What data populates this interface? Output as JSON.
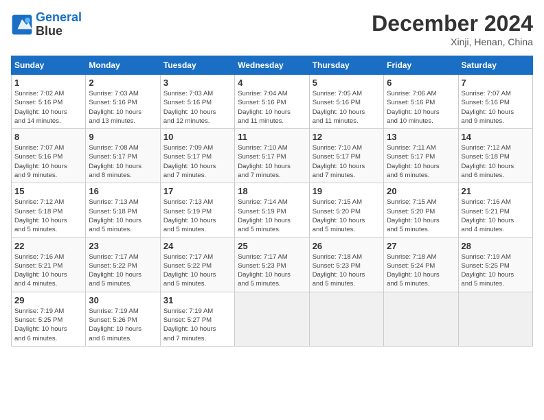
{
  "header": {
    "logo_line1": "General",
    "logo_line2": "Blue",
    "month": "December 2024",
    "location": "Xinji, Henan, China"
  },
  "weekdays": [
    "Sunday",
    "Monday",
    "Tuesday",
    "Wednesday",
    "Thursday",
    "Friday",
    "Saturday"
  ],
  "weeks": [
    [
      {
        "day": "1",
        "info": "Sunrise: 7:02 AM\nSunset: 5:16 PM\nDaylight: 10 hours\nand 14 minutes."
      },
      {
        "day": "2",
        "info": "Sunrise: 7:03 AM\nSunset: 5:16 PM\nDaylight: 10 hours\nand 13 minutes."
      },
      {
        "day": "3",
        "info": "Sunrise: 7:03 AM\nSunset: 5:16 PM\nDaylight: 10 hours\nand 12 minutes."
      },
      {
        "day": "4",
        "info": "Sunrise: 7:04 AM\nSunset: 5:16 PM\nDaylight: 10 hours\nand 11 minutes."
      },
      {
        "day": "5",
        "info": "Sunrise: 7:05 AM\nSunset: 5:16 PM\nDaylight: 10 hours\nand 11 minutes."
      },
      {
        "day": "6",
        "info": "Sunrise: 7:06 AM\nSunset: 5:16 PM\nDaylight: 10 hours\nand 10 minutes."
      },
      {
        "day": "7",
        "info": "Sunrise: 7:07 AM\nSunset: 5:16 PM\nDaylight: 10 hours\nand 9 minutes."
      }
    ],
    [
      {
        "day": "8",
        "info": "Sunrise: 7:07 AM\nSunset: 5:16 PM\nDaylight: 10 hours\nand 9 minutes."
      },
      {
        "day": "9",
        "info": "Sunrise: 7:08 AM\nSunset: 5:17 PM\nDaylight: 10 hours\nand 8 minutes."
      },
      {
        "day": "10",
        "info": "Sunrise: 7:09 AM\nSunset: 5:17 PM\nDaylight: 10 hours\nand 7 minutes."
      },
      {
        "day": "11",
        "info": "Sunrise: 7:10 AM\nSunset: 5:17 PM\nDaylight: 10 hours\nand 7 minutes."
      },
      {
        "day": "12",
        "info": "Sunrise: 7:10 AM\nSunset: 5:17 PM\nDaylight: 10 hours\nand 7 minutes."
      },
      {
        "day": "13",
        "info": "Sunrise: 7:11 AM\nSunset: 5:17 PM\nDaylight: 10 hours\nand 6 minutes."
      },
      {
        "day": "14",
        "info": "Sunrise: 7:12 AM\nSunset: 5:18 PM\nDaylight: 10 hours\nand 6 minutes."
      }
    ],
    [
      {
        "day": "15",
        "info": "Sunrise: 7:12 AM\nSunset: 5:18 PM\nDaylight: 10 hours\nand 5 minutes."
      },
      {
        "day": "16",
        "info": "Sunrise: 7:13 AM\nSunset: 5:18 PM\nDaylight: 10 hours\nand 5 minutes."
      },
      {
        "day": "17",
        "info": "Sunrise: 7:13 AM\nSunset: 5:19 PM\nDaylight: 10 hours\nand 5 minutes."
      },
      {
        "day": "18",
        "info": "Sunrise: 7:14 AM\nSunset: 5:19 PM\nDaylight: 10 hours\nand 5 minutes."
      },
      {
        "day": "19",
        "info": "Sunrise: 7:15 AM\nSunset: 5:20 PM\nDaylight: 10 hours\nand 5 minutes."
      },
      {
        "day": "20",
        "info": "Sunrise: 7:15 AM\nSunset: 5:20 PM\nDaylight: 10 hours\nand 5 minutes."
      },
      {
        "day": "21",
        "info": "Sunrise: 7:16 AM\nSunset: 5:21 PM\nDaylight: 10 hours\nand 4 minutes."
      }
    ],
    [
      {
        "day": "22",
        "info": "Sunrise: 7:16 AM\nSunset: 5:21 PM\nDaylight: 10 hours\nand 4 minutes."
      },
      {
        "day": "23",
        "info": "Sunrise: 7:17 AM\nSunset: 5:22 PM\nDaylight: 10 hours\nand 5 minutes."
      },
      {
        "day": "24",
        "info": "Sunrise: 7:17 AM\nSunset: 5:22 PM\nDaylight: 10 hours\nand 5 minutes."
      },
      {
        "day": "25",
        "info": "Sunrise: 7:17 AM\nSunset: 5:23 PM\nDaylight: 10 hours\nand 5 minutes."
      },
      {
        "day": "26",
        "info": "Sunrise: 7:18 AM\nSunset: 5:23 PM\nDaylight: 10 hours\nand 5 minutes."
      },
      {
        "day": "27",
        "info": "Sunrise: 7:18 AM\nSunset: 5:24 PM\nDaylight: 10 hours\nand 5 minutes."
      },
      {
        "day": "28",
        "info": "Sunrise: 7:19 AM\nSunset: 5:25 PM\nDaylight: 10 hours\nand 5 minutes."
      }
    ],
    [
      {
        "day": "29",
        "info": "Sunrise: 7:19 AM\nSunset: 5:25 PM\nDaylight: 10 hours\nand 6 minutes."
      },
      {
        "day": "30",
        "info": "Sunrise: 7:19 AM\nSunset: 5:26 PM\nDaylight: 10 hours\nand 6 minutes."
      },
      {
        "day": "31",
        "info": "Sunrise: 7:19 AM\nSunset: 5:27 PM\nDaylight: 10 hours\nand 7 minutes."
      },
      null,
      null,
      null,
      null
    ]
  ]
}
